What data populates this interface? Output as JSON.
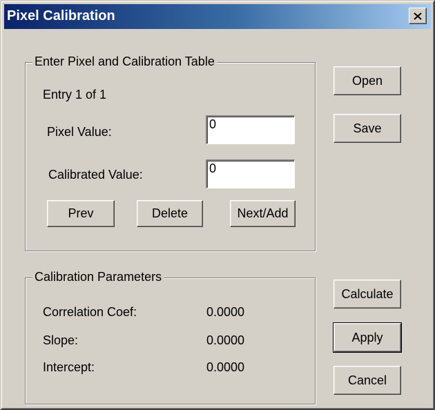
{
  "window": {
    "title": "Pixel Calibration",
    "close_icon": "close-icon"
  },
  "table_group": {
    "legend": "Enter Pixel and Calibration Table",
    "entry_status": "Entry 1 of 1",
    "pixel_label": "Pixel Value:",
    "pixel_value": "0",
    "calibrated_label": "Calibrated Value:",
    "calibrated_value": "0",
    "prev_label": "Prev",
    "delete_label": "Delete",
    "next_label": "Next/Add"
  },
  "params_group": {
    "legend": "Calibration Parameters",
    "rows": [
      {
        "label": "Correlation Coef:",
        "value": "0.0000"
      },
      {
        "label": "Slope:",
        "value": "0.0000"
      },
      {
        "label": "Intercept:",
        "value": "0.0000"
      }
    ]
  },
  "buttons": {
    "open": "Open",
    "save": "Save",
    "calculate": "Calculate",
    "apply": "Apply",
    "cancel": "Cancel"
  },
  "colors": {
    "face": "#d4d0c8",
    "title_start": "#0a246a",
    "title_end": "#a6caf0"
  }
}
